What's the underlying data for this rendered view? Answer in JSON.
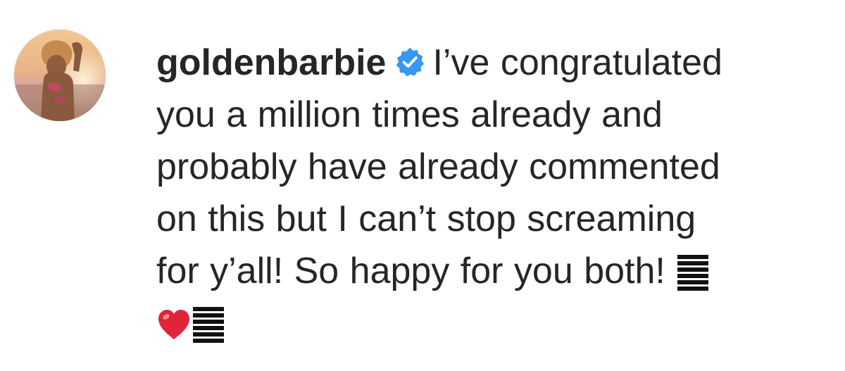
{
  "comment": {
    "username": "goldenbarbie",
    "verified": true,
    "text_lines": [
      "I’ve congratulated",
      "you a million times already and",
      "probably have already commented",
      "on this but I can’t stop screaming",
      "for y’all! So happy for you both!"
    ],
    "emojis": [
      "heart-emoji",
      "unrendered-emoji"
    ]
  },
  "colors": {
    "text": "#262626",
    "verified_badge": "#3897f0",
    "heart": "#e0253b"
  },
  "icons": {
    "verified": "verified-badge-icon",
    "avatar": "profile-avatar"
  }
}
